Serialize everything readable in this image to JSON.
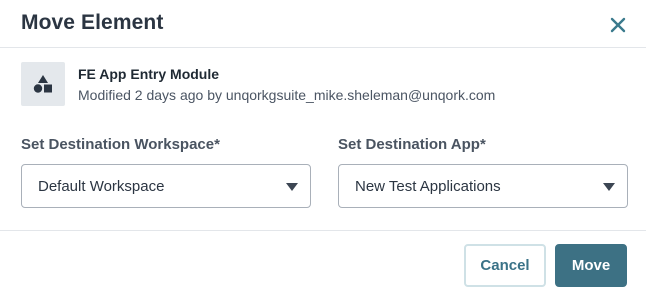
{
  "dialog": {
    "title": "Move Element",
    "close_icon": "close-icon"
  },
  "element": {
    "icon": "shapes-icon",
    "name": "FE App Entry Module",
    "meta": "Modified 2 days ago by unqorkgsuite_mike.sheleman@unqork.com"
  },
  "workspace_field": {
    "label": "Set Destination Workspace*",
    "value": "Default Workspace",
    "icon": "caret-down-icon"
  },
  "app_field": {
    "label": "Set Destination App*",
    "value": "New Test Applications",
    "icon": "caret-down-icon"
  },
  "footer": {
    "cancel_label": "Cancel",
    "move_label": "Move"
  },
  "colors": {
    "primary": "#3d7184",
    "close": "#3a7a8c",
    "text": "#2b3542"
  }
}
